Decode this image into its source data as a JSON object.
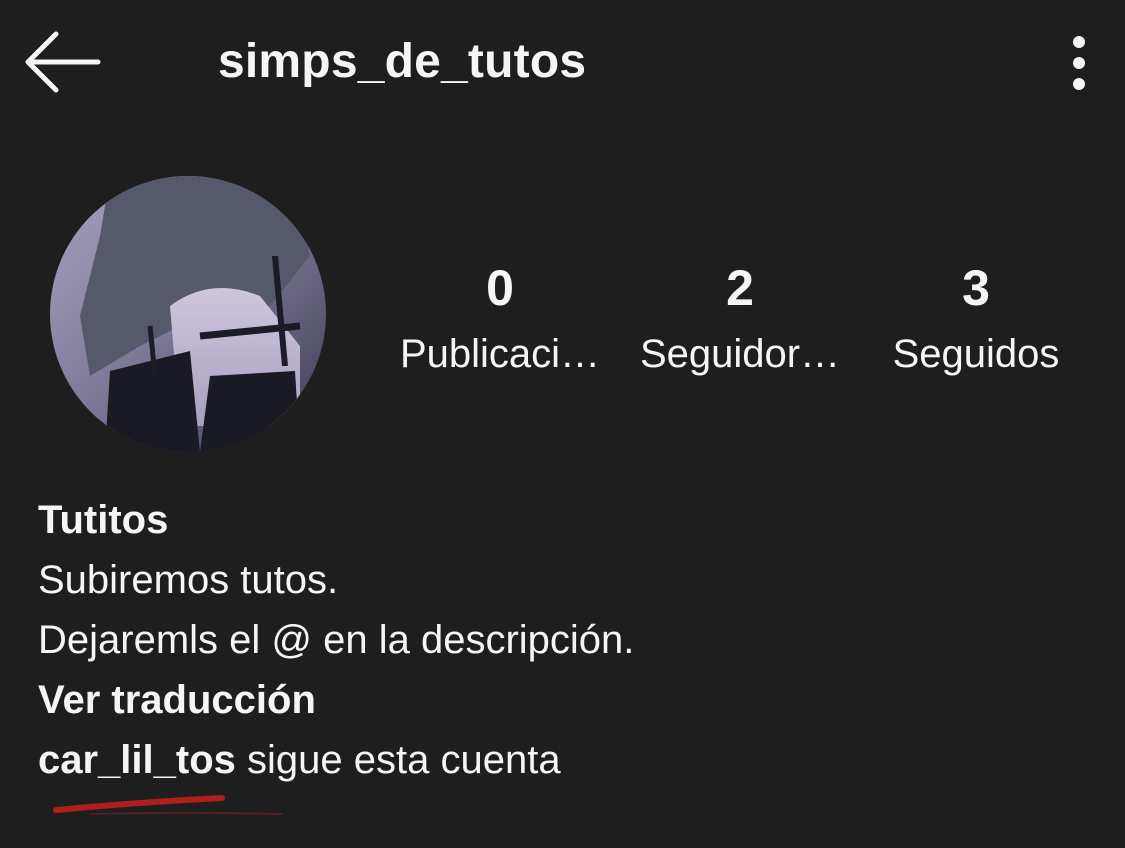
{
  "header": {
    "title": "simps_de_tutos",
    "back_icon": "arrow-left-icon",
    "menu_icon": "more-vertical-icon"
  },
  "profile": {
    "avatar_icon": "profile-photo",
    "stats": [
      {
        "value": "0",
        "label": "Publicaci…"
      },
      {
        "value": "2",
        "label": "Seguidor…"
      },
      {
        "value": "3",
        "label": "Seguidos"
      }
    ]
  },
  "bio": {
    "name": "Tutitos",
    "line1": "Subiremos tutos.",
    "line2": "Dejaremls el @ en la descripción.",
    "translate": "Ver traducción",
    "follower_username": "car_lil_tos",
    "follower_suffix": "sigue esta cuenta"
  },
  "colors": {
    "background": "#1e1e1f",
    "text": "#f5f5f5",
    "annotation": "#b01e1e"
  }
}
